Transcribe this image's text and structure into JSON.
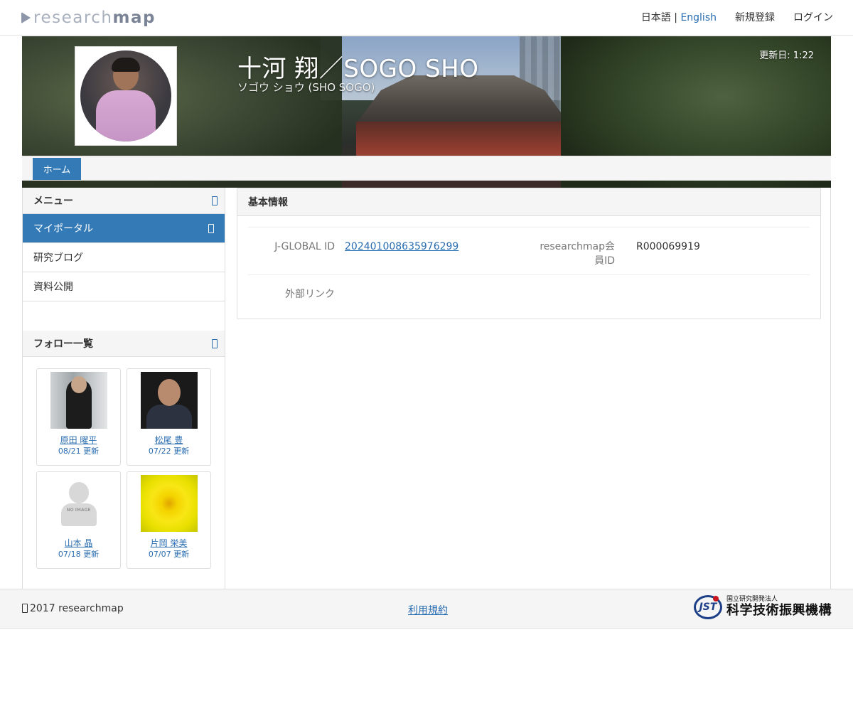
{
  "header": {
    "logo_light": "research",
    "logo_bold": "map",
    "lang_ja": "日本語",
    "lang_sep": "|",
    "lang_en": "English",
    "register": "新規登録",
    "login": "ログイン"
  },
  "profile": {
    "name": "十河 翔／SOGO SHO",
    "kana": "ソゴウ ショウ  (SHO SOGO)",
    "updated": "更新日: 1:22",
    "tab_home": "ホーム"
  },
  "sidebar": {
    "menu_heading": "メニュー",
    "items": [
      {
        "label": "マイポータル",
        "active": true
      },
      {
        "label": "研究ブログ",
        "active": false
      },
      {
        "label": "資料公開",
        "active": false
      }
    ],
    "follow_heading": "フォロー一覧",
    "follows": [
      {
        "name": "原田 曜平",
        "date": "08/21 更新"
      },
      {
        "name": "松尾 豊",
        "date": "07/22 更新"
      },
      {
        "name": "山本 晶",
        "date": "07/18 更新",
        "no_image": "NO IMAGE"
      },
      {
        "name": "片岡 栄美",
        "date": "07/07 更新"
      }
    ]
  },
  "basic_info": {
    "heading": "基本情報",
    "jglobal_label": "J-GLOBAL ID",
    "jglobal_value": "202401008635976299",
    "member_label_1": "researchmap会",
    "member_label_2": "員ID",
    "member_value": "R000069919",
    "external_label": "外部リンク"
  },
  "footer": {
    "copyright": "2017 researchmap",
    "terms": "利用規約",
    "jst_small": "国立研究開発法人",
    "jst_big": "科学技術振興機構",
    "jst_mark": "JST"
  },
  "colors": {
    "primary": "#337ab7",
    "link": "#2a6db0",
    "panel_bg": "#f5f5f5"
  }
}
